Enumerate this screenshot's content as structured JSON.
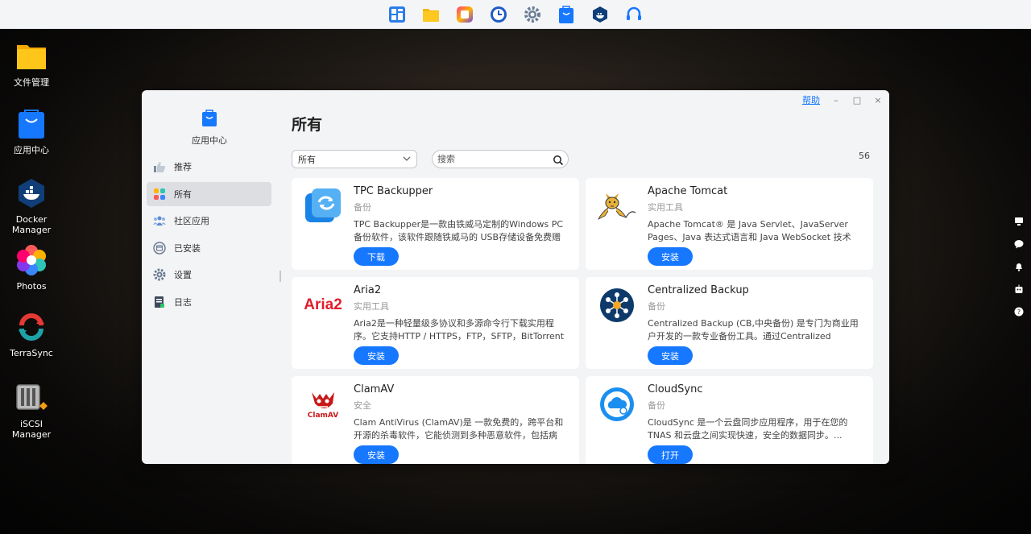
{
  "desktop": {
    "icons": [
      {
        "label": "文件管理"
      },
      {
        "label": "应用中心"
      },
      {
        "label": "Docker Manager"
      },
      {
        "label": "Photos"
      },
      {
        "label": "TerraSync"
      },
      {
        "label": "iSCSI Manager"
      }
    ]
  },
  "window": {
    "help_label": "帮助",
    "minimize_glyph": "–",
    "maximize_glyph": "□",
    "close_glyph": "×"
  },
  "sidebar": {
    "title": "应用中心",
    "items": [
      {
        "label": "推荐",
        "icon": "thumbs-up-icon"
      },
      {
        "label": "所有",
        "icon": "grid-icon"
      },
      {
        "label": "社区应用",
        "icon": "community-icon"
      },
      {
        "label": "已安装",
        "icon": "installed-icon"
      },
      {
        "label": "设置",
        "icon": "gear-icon"
      },
      {
        "label": "日志",
        "icon": "log-icon"
      }
    ]
  },
  "main": {
    "title": "所有",
    "filter": {
      "selected": "所有"
    },
    "search": {
      "placeholder": "搜索",
      "value": ""
    },
    "count": "56",
    "apps": [
      {
        "name": "TPC Backupper",
        "category": "备份",
        "description": "TPC Backupper是一款由铁威马定制的Windows PC 备份软件，该软件跟随铁威马的 USB存储设备免费赠送...",
        "action": "下载"
      },
      {
        "name": "Apache Tomcat",
        "category": "实用工具",
        "description": "Apache Tomcat® 是 Java Servlet、JavaServer Pages、Java 表达式语言和 Java WebSocket 技术的...",
        "action": "安装"
      },
      {
        "name": "Aria2",
        "category": "实用工具",
        "description": "Aria2是一种轻量级多协议和多源命令行下载实用程序。它支持HTTP / HTTPS，FTP，SFTP，BitTorrent和...",
        "action": "安装",
        "logo_text": "Aria2"
      },
      {
        "name": "Centralized Backup",
        "category": "备份",
        "description": "Centralized Backup (CB,中央备份) 是专门为商业用户开发的一款专业备份工具。通过Centralized Backup...",
        "action": "安装"
      },
      {
        "name": "ClamAV",
        "category": "安全",
        "description": "Clam AntiVirus (ClamAV)是 一款免费的，跨平台和开源的杀毒软件，它能侦测到多种恶意软件，包括病毒。",
        "action": "安装",
        "logo_text": "ClamAV"
      },
      {
        "name": "CloudSync",
        "category": "备份",
        "description": "CloudSync 是一个云盘同步应用程序，用于在您的TNAS 和云盘之间实现快速，安全的数据同步。...",
        "action": "打开"
      }
    ]
  }
}
